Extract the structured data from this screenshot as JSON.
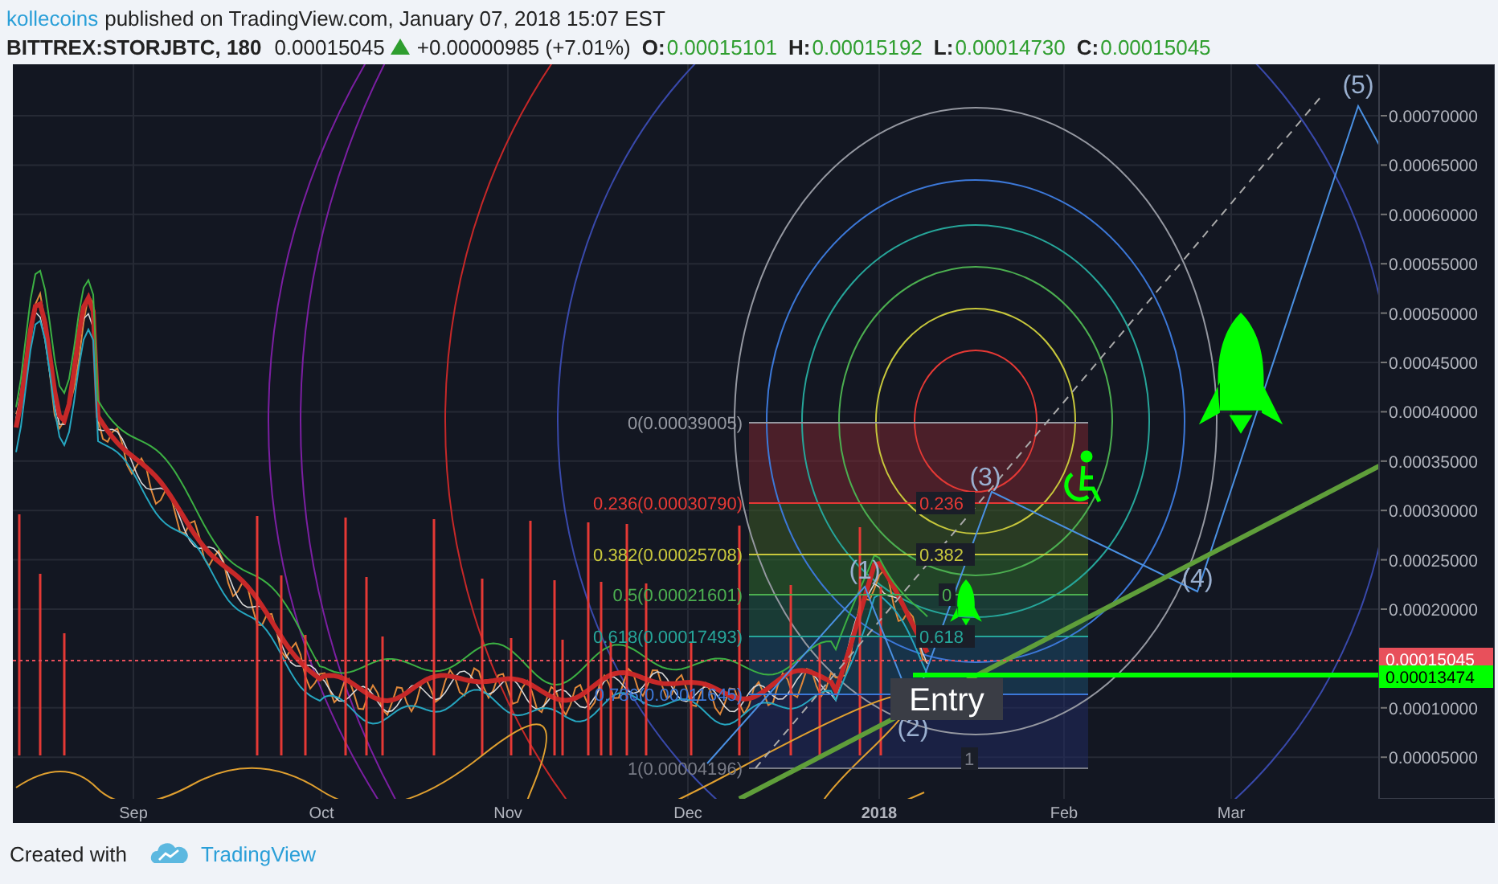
{
  "header": {
    "author": "kollecoins",
    "published": "published on TradingView.com, January 07, 2018 15:07 EST"
  },
  "symbol_bar": {
    "symbol": "BITTREX:STORJBTC, 180",
    "price": "0.00015045",
    "rising": true,
    "change": "+0.00000985 (+7.01%)",
    "ohlc": [
      {
        "key": "O:",
        "value": "0.00015101"
      },
      {
        "key": "H:",
        "value": "0.00015192"
      },
      {
        "key": "L:",
        "value": "0.00014730"
      },
      {
        "key": "C:",
        "value": "0.00015045"
      }
    ]
  },
  "chart": {
    "price_axis": [
      "0.00070000",
      "0.00065000",
      "0.00060000",
      "0.00055000",
      "0.00050000",
      "0.00045000",
      "0.00040000",
      "0.00035000",
      "0.00030000",
      "0.00025000",
      "0.00020000",
      "0.00010000",
      "0.00005000"
    ],
    "time_axis": [
      {
        "label": "Sep",
        "bold": false
      },
      {
        "label": "Oct",
        "bold": false
      },
      {
        "label": "Nov",
        "bold": false
      },
      {
        "label": "Dec",
        "bold": false
      },
      {
        "label": "2018",
        "bold": true
      },
      {
        "label": "Feb",
        "bold": false
      },
      {
        "label": "Mar",
        "bold": false
      }
    ],
    "price_labels": [
      {
        "text": "0.00015045",
        "color": "#e8505b"
      },
      {
        "text": "0.00013474",
        "color": "#00ff00"
      }
    ],
    "fib_levels": [
      {
        "label": "0(0.00039005)",
        "color": "#9598a1"
      },
      {
        "label": "0.236(0.00030790)",
        "inline": "0.236",
        "color": "#e53935"
      },
      {
        "label": "0.382(0.00025708)",
        "inline": "0.382",
        "color": "#c8c83c"
      },
      {
        "label": "0.5(0.00021601)",
        "inline": "0",
        "color": "#4caf50"
      },
      {
        "label": "0.618(0.00017493)",
        "inline": "0.618",
        "color": "#26a69a"
      },
      {
        "label": "0.786(0.00011645)",
        "color": "#3c78d8"
      },
      {
        "label": "1(0.00004196)",
        "inline": "1",
        "color": "#787b86"
      }
    ],
    "wave_labels": [
      "(1)",
      "(2)",
      "(3)",
      "(4)",
      "(5)"
    ],
    "entry_label": "Entry"
  },
  "footer": {
    "created_with": "Created with",
    "brand": "TradingView"
  }
}
